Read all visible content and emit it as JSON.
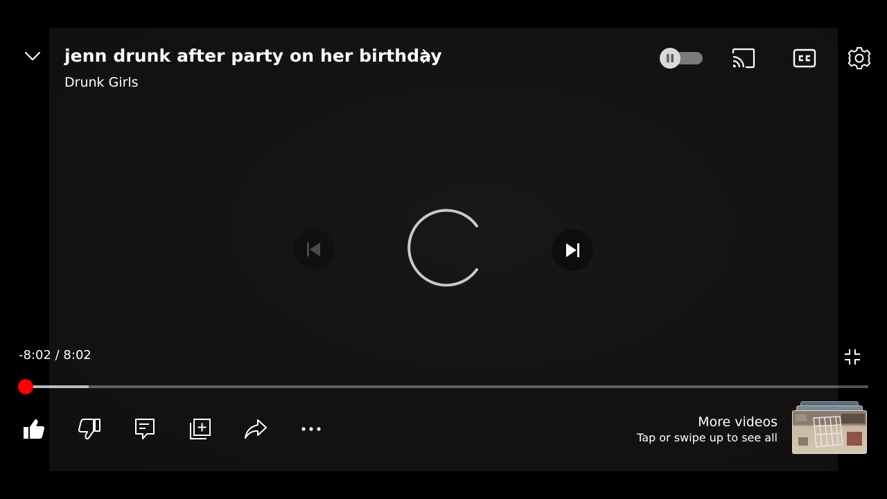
{
  "video": {
    "title": "jenn drunk after party on her birthday",
    "channel": "Drunk Girls",
    "time_display": "-8:02 / 8:02",
    "progress_fraction": 0.0,
    "buffered_fraction": 0.075
  },
  "top_controls": {
    "autoplay_enabled": false
  },
  "colors": {
    "progress_played": "#ff0000",
    "scrubber": "#ff0000"
  },
  "icons": {
    "collapse": "chevron-down-icon",
    "title_more": "chevron-right-icon",
    "autoplay": "pause-icon",
    "cast": "cast-icon",
    "captions": "cc-icon",
    "settings": "gear-icon",
    "previous": "skip-previous-icon",
    "loading": "loading-spinner-icon",
    "next": "skip-next-icon",
    "exit_fullscreen": "exit-fullscreen-icon",
    "like": "thumbs-up-icon",
    "dislike": "thumbs-down-icon",
    "comments": "comment-icon",
    "save": "add-to-playlist-icon",
    "share": "share-icon",
    "more": "more-horizontal-icon"
  },
  "more_videos": {
    "title": "More videos",
    "subtitle": "Tap or swipe up to see all"
  }
}
